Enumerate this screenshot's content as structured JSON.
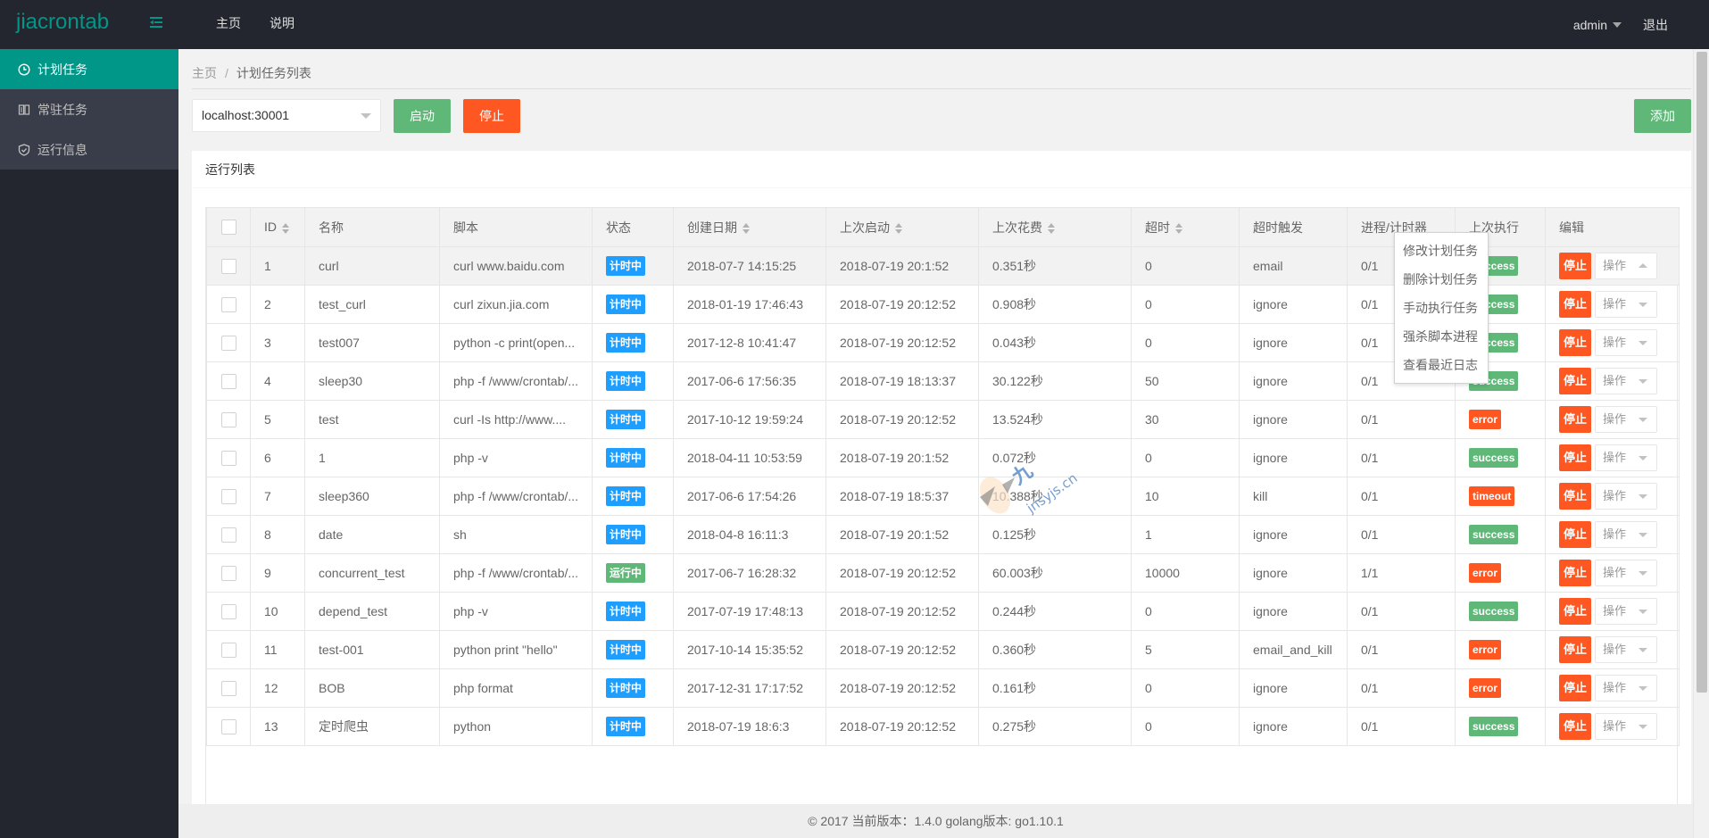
{
  "header": {
    "logo": "jiacrontab",
    "nav": [
      "主页",
      "说明"
    ],
    "user": "admin",
    "logout": "退出"
  },
  "sidebar": {
    "items": [
      {
        "label": "计划任务",
        "icon": "clock-icon",
        "active": true
      },
      {
        "label": "常驻任务",
        "icon": "columns-icon",
        "active": false
      },
      {
        "label": "运行信息",
        "icon": "shield-check-icon",
        "active": false
      }
    ]
  },
  "breadcrumb": {
    "home": "主页",
    "separator": "/",
    "current": "计划任务列表"
  },
  "toolbar": {
    "host_value": "localhost:30001",
    "start_label": "启动",
    "stop_label": "停止",
    "add_label": "添加"
  },
  "card": {
    "title": "运行列表"
  },
  "table": {
    "columns": [
      "ID",
      "名称",
      "脚本",
      "状态",
      "创建日期",
      "上次启动",
      "上次花费",
      "超时",
      "超时触发",
      "进程/计时器",
      "上次执行",
      "编辑"
    ],
    "sortable": [
      true,
      false,
      false,
      false,
      true,
      true,
      true,
      true,
      false,
      false,
      false,
      false
    ],
    "stop_label": "停止",
    "op_label": "操作",
    "rows": [
      {
        "id": "1",
        "name": "curl",
        "script": "curl www.baidu.com",
        "state": "计时中",
        "state_color": "blue",
        "created": "2018-07-7 14:15:25",
        "last_start": "2018-07-19 20:1:52",
        "last_cost": "0.351秒",
        "timeout": "0",
        "timeout_trigger": "email",
        "proc": "0/1",
        "last_result": "success",
        "result_color": "green"
      },
      {
        "id": "2",
        "name": "test_curl",
        "script": "curl zixun.jia.com",
        "state": "计时中",
        "state_color": "blue",
        "created": "2018-01-19 17:46:43",
        "last_start": "2018-07-19 20:12:52",
        "last_cost": "0.908秒",
        "timeout": "0",
        "timeout_trigger": "ignore",
        "proc": "0/1",
        "last_result": "success",
        "result_color": "green"
      },
      {
        "id": "3",
        "name": "test007",
        "script": "python -c print(open...",
        "state": "计时中",
        "state_color": "blue",
        "created": "2017-12-8 10:41:47",
        "last_start": "2018-07-19 20:12:52",
        "last_cost": "0.043秒",
        "timeout": "0",
        "timeout_trigger": "ignore",
        "proc": "0/1",
        "last_result": "success",
        "result_color": "green"
      },
      {
        "id": "4",
        "name": "sleep30",
        "script": "php -f /www/crontab/...",
        "state": "计时中",
        "state_color": "blue",
        "created": "2017-06-6 17:56:35",
        "last_start": "2018-07-19 18:13:37",
        "last_cost": "30.122秒",
        "timeout": "50",
        "timeout_trigger": "ignore",
        "proc": "0/1",
        "last_result": "success",
        "result_color": "green"
      },
      {
        "id": "5",
        "name": "test",
        "script": "curl -Is http://www....",
        "state": "计时中",
        "state_color": "blue",
        "created": "2017-10-12 19:59:24",
        "last_start": "2018-07-19 20:12:52",
        "last_cost": "13.524秒",
        "timeout": "30",
        "timeout_trigger": "ignore",
        "proc": "0/1",
        "last_result": "error",
        "result_color": "red"
      },
      {
        "id": "6",
        "name": "1",
        "script": "php -v",
        "state": "计时中",
        "state_color": "blue",
        "created": "2018-04-11 10:53:59",
        "last_start": "2018-07-19 20:1:52",
        "last_cost": "0.072秒",
        "timeout": "0",
        "timeout_trigger": "ignore",
        "proc": "0/1",
        "last_result": "success",
        "result_color": "green"
      },
      {
        "id": "7",
        "name": "sleep360",
        "script": "php -f /www/crontab/...",
        "state": "计时中",
        "state_color": "blue",
        "created": "2017-06-6 17:54:26",
        "last_start": "2018-07-19 18:5:37",
        "last_cost": "10.388秒",
        "timeout": "10",
        "timeout_trigger": "kill",
        "proc": "0/1",
        "last_result": "timeout",
        "result_color": "red"
      },
      {
        "id": "8",
        "name": "date",
        "script": "sh",
        "state": "计时中",
        "state_color": "blue",
        "created": "2018-04-8 16:11:3",
        "last_start": "2018-07-19 20:1:52",
        "last_cost": "0.125秒",
        "timeout": "1",
        "timeout_trigger": "ignore",
        "proc": "0/1",
        "last_result": "success",
        "result_color": "green"
      },
      {
        "id": "9",
        "name": "concurrent_test",
        "script": "php -f /www/crontab/...",
        "state": "运行中",
        "state_color": "green",
        "created": "2017-06-7 16:28:32",
        "last_start": "2018-07-19 20:12:52",
        "last_cost": "60.003秒",
        "timeout": "10000",
        "timeout_trigger": "ignore",
        "proc": "1/1",
        "last_result": "error",
        "result_color": "red"
      },
      {
        "id": "10",
        "name": "depend_test",
        "script": "php -v",
        "state": "计时中",
        "state_color": "blue",
        "created": "2017-07-19 17:48:13",
        "last_start": "2018-07-19 20:12:52",
        "last_cost": "0.244秒",
        "timeout": "0",
        "timeout_trigger": "ignore",
        "proc": "0/1",
        "last_result": "success",
        "result_color": "green"
      },
      {
        "id": "11",
        "name": "test-001",
        "script": "python print \"hello\"",
        "state": "计时中",
        "state_color": "blue",
        "created": "2017-10-14 15:35:52",
        "last_start": "2018-07-19 20:12:52",
        "last_cost": "0.360秒",
        "timeout": "5",
        "timeout_trigger": "email_and_kill",
        "proc": "0/1",
        "last_result": "error",
        "result_color": "red"
      },
      {
        "id": "12",
        "name": "BOB",
        "script": "php format",
        "state": "计时中",
        "state_color": "blue",
        "created": "2017-12-31 17:17:52",
        "last_start": "2018-07-19 20:12:52",
        "last_cost": "0.161秒",
        "timeout": "0",
        "timeout_trigger": "ignore",
        "proc": "0/1",
        "last_result": "error",
        "result_color": "red"
      },
      {
        "id": "13",
        "name": "定时爬虫",
        "script": "python",
        "state": "计时中",
        "state_color": "blue",
        "created": "2018-07-19 18:6:3",
        "last_start": "2018-07-19 20:12:52",
        "last_cost": "0.275秒",
        "timeout": "0",
        "timeout_trigger": "ignore",
        "proc": "0/1",
        "last_result": "success",
        "result_color": "green"
      }
    ]
  },
  "dropdown": {
    "open_row": 0,
    "items": [
      "修改计划任务",
      "删除计划任务",
      "手动执行任务",
      "强杀脚本进程",
      "查看最近日志"
    ]
  },
  "watermark": {
    "text": "jnsyjs.cn"
  },
  "footer": {
    "text": "© 2017 当前版本：1.4.0 golang版本: go1.10.1"
  },
  "colors": {
    "brand": "#009688",
    "header_bg": "#23262e",
    "green": "#5fb878",
    "red": "#ff5722",
    "blue": "#1e9fff"
  }
}
